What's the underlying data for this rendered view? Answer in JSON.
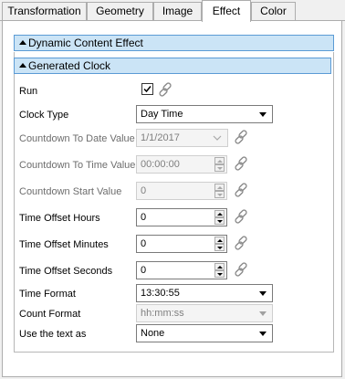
{
  "tabs": [
    {
      "label": "Transformation"
    },
    {
      "label": "Geometry"
    },
    {
      "label": "Image"
    },
    {
      "label": "Effect",
      "active": true
    },
    {
      "label": "Color"
    }
  ],
  "groups": {
    "outer": "Dynamic Content Effect",
    "inner": "Generated Clock"
  },
  "rows": [
    {
      "label": "Run",
      "type": "checkbox",
      "checked": true,
      "enabled": true
    },
    {
      "label": "Clock Type",
      "type": "dropdown",
      "value": "Day Time",
      "enabled": true
    },
    {
      "label": "Countdown To Date Value",
      "type": "date",
      "value": "1/1/2017",
      "enabled": false
    },
    {
      "label": "Countdown To Time Value",
      "type": "spin",
      "value": "00:00:00",
      "enabled": false
    },
    {
      "label": "Countdown Start Value",
      "type": "spin",
      "value": "0",
      "enabled": false
    },
    {
      "label": "Time Offset Hours",
      "type": "spin",
      "value": "0",
      "enabled": true
    },
    {
      "label": "Time Offset Minutes",
      "type": "spin",
      "value": "0",
      "enabled": true
    },
    {
      "label": "Time Offset Seconds",
      "type": "spin",
      "value": "0",
      "enabled": true
    },
    {
      "label": "Time Format",
      "type": "dropdown",
      "value": "13:30:55",
      "enabled": true
    },
    {
      "label": "Count Format",
      "type": "dropdown",
      "value": "hh:mm:ss",
      "enabled": false
    },
    {
      "label": "Use the text as",
      "type": "dropdown",
      "value": "None",
      "enabled": true
    }
  ],
  "icons": {
    "link": "chain-link-icon",
    "check": "checkmark-icon"
  },
  "colors": {
    "header_bg": "#cbe4f6",
    "header_border": "#5b9bd5",
    "link_icon": "#8a8a8a"
  }
}
